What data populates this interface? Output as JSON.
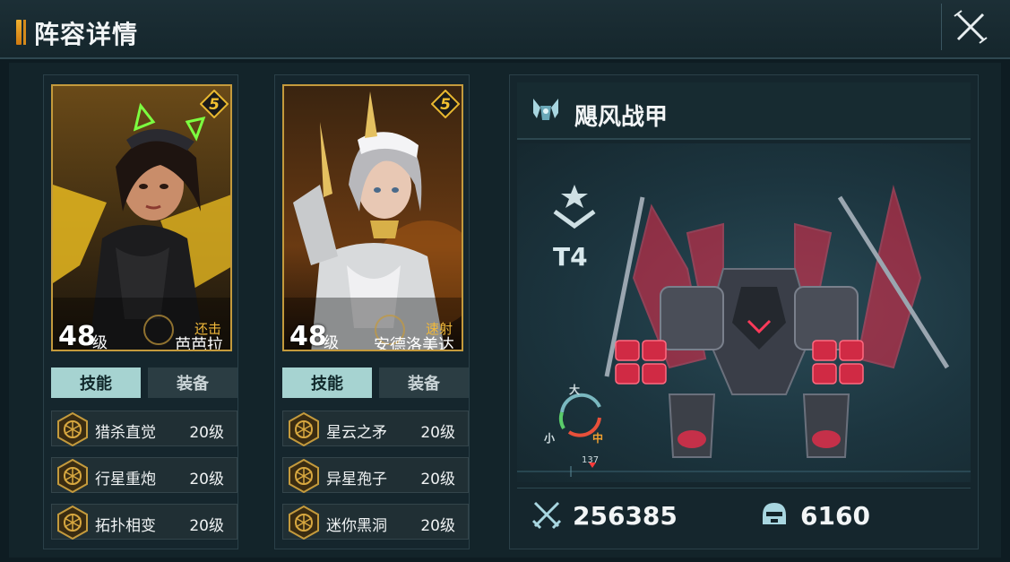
{
  "header": {
    "title": "阵容详情"
  },
  "heroes": [
    {
      "level": "48",
      "level_unit": "级",
      "role": "还击",
      "name": "芭芭拉",
      "rarity": "5",
      "tabs": {
        "skills": "技能",
        "equipment": "装备"
      },
      "skills": [
        {
          "name": "猎杀直觉",
          "level": "20级"
        },
        {
          "name": "行星重炮",
          "level": "20级"
        },
        {
          "name": "拓扑相变",
          "level": "20级"
        }
      ]
    },
    {
      "level": "48",
      "level_unit": "级",
      "role": "速射",
      "name": "安德洛美达",
      "rarity": "5",
      "tabs": {
        "skills": "技能",
        "equipment": "装备"
      },
      "skills": [
        {
          "name": "星云之矛",
          "level": "20级"
        },
        {
          "name": "异星孢子",
          "level": "20级"
        },
        {
          "name": "迷你黑洞",
          "level": "20级"
        }
      ]
    }
  ],
  "mech": {
    "name": "飓风战甲",
    "tier": "T4",
    "size_labels": {
      "big": "大",
      "small": "小",
      "mid": "中"
    },
    "ruler_value": "137",
    "attack": "256385",
    "defense": "6160"
  },
  "colors": {
    "accent_gold": "#c49a3c",
    "tab_active": "#a6d3d1",
    "mech_glow": "#ff2a4a"
  },
  "icons": {
    "close": "close-icon",
    "mech_type": "mech-emblem-icon",
    "attack": "crossed-swords-icon",
    "defense": "helmet-icon"
  }
}
